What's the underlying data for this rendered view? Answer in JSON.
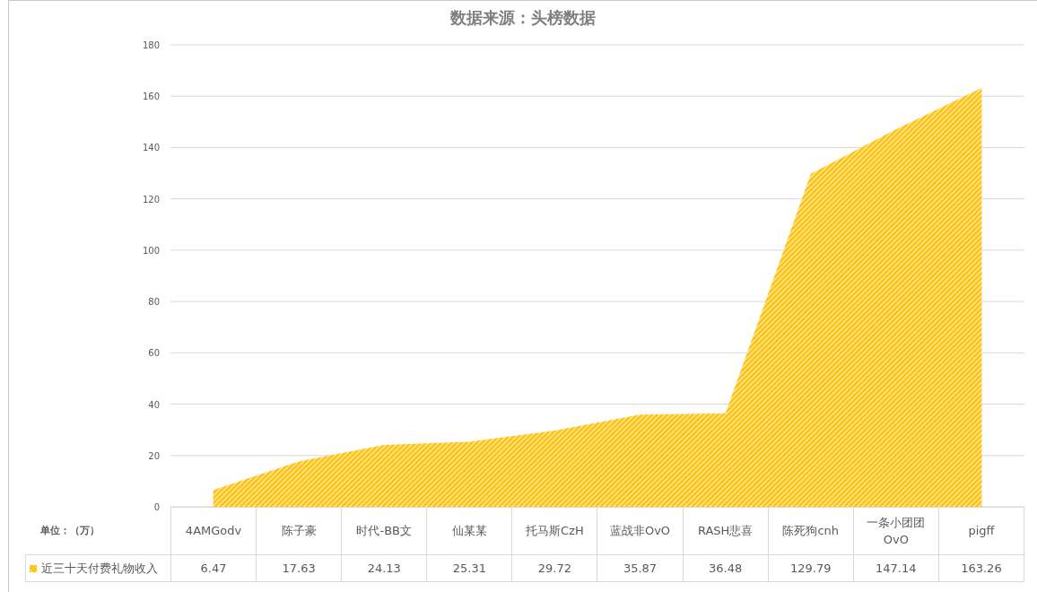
{
  "chart": {
    "chart_data": {
      "type": "area",
      "title": "数据来源：头榜数据",
      "grid": true,
      "categories": [
        "4AMGodv",
        "陈子豪",
        "时代-BB文",
        "仙某某",
        "托马斯CzH",
        "蓝战非OvO",
        "RASH悲喜",
        "陈死狗cnh",
        "一条小团团OvO",
        "pigff"
      ],
      "series": [
        {
          "name": "近三十天付费礼物收入",
          "color": "#ffc000",
          "values": [
            6.47,
            17.63,
            24.13,
            25.31,
            29.72,
            35.87,
            36.48,
            129.79,
            147.14,
            163.26
          ]
        }
      ],
      "ylim": [
        0,
        180
      ],
      "yticks": [
        0,
        20,
        40,
        60,
        80,
        100,
        120,
        140,
        160,
        180
      ]
    },
    "data_table": {
      "unit_label": "单位：（万）",
      "values": [
        "6.47",
        "17.63",
        "24.13",
        "25.31",
        "29.72",
        "35.87",
        "36.48",
        "129.79",
        "147.14",
        "163.26"
      ]
    }
  }
}
